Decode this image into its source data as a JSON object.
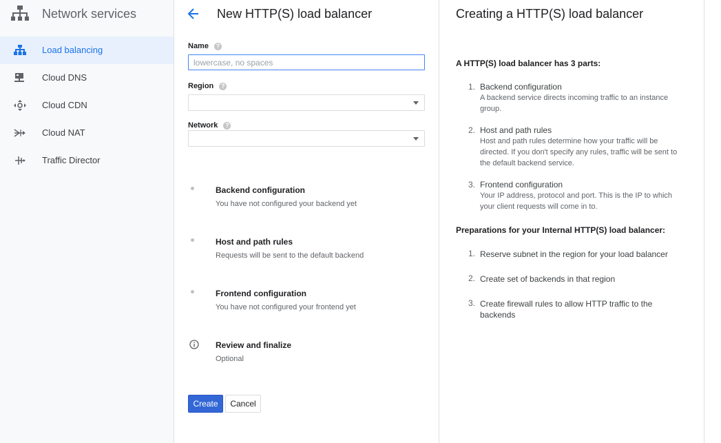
{
  "sidebar": {
    "title": "Network services",
    "items": [
      {
        "label": "Load balancing",
        "icon": "load-balancing-icon"
      },
      {
        "label": "Cloud DNS",
        "icon": "cloud-dns-icon"
      },
      {
        "label": "Cloud CDN",
        "icon": "cloud-cdn-icon"
      },
      {
        "label": "Cloud NAT",
        "icon": "cloud-nat-icon"
      },
      {
        "label": "Traffic Director",
        "icon": "traffic-director-icon"
      }
    ]
  },
  "main": {
    "title": "New HTTP(S) load balancer",
    "name_label": "Name",
    "name_placeholder": "lowercase, no spaces",
    "name_value": "",
    "region_label": "Region",
    "region_value": "",
    "network_label": "Network",
    "network_value": "",
    "steps": [
      {
        "title": "Backend configuration",
        "desc": "You have not configured your backend yet"
      },
      {
        "title": "Host and path rules",
        "desc": "Requests will be sent to the default backend"
      },
      {
        "title": "Frontend configuration",
        "desc": "You have not configured your frontend yet"
      },
      {
        "title": "Review and finalize",
        "desc": "Optional"
      }
    ],
    "create_label": "Create",
    "cancel_label": "Cancel"
  },
  "help": {
    "title": "Creating a HTTP(S) load balancer",
    "parts_heading": "A HTTP(S) load balancer has 3 parts:",
    "parts": [
      {
        "num": "1.",
        "title": "Backend configuration",
        "desc": "A backend service directs incoming traffic to an instance group."
      },
      {
        "num": "2.",
        "title": "Host and path rules",
        "desc": "Host and path rules determine how your traffic will be directed. If you don't specify any rules, traffic will be sent to the default backend service."
      },
      {
        "num": "3.",
        "title": "Frontend configuration",
        "desc": "Your IP address, protocol and port. This is the IP to which your client requests will come in to."
      }
    ],
    "prep_heading": "Preparations for your Internal HTTP(S) load balancer:",
    "preps": [
      {
        "num": "1.",
        "text": "Reserve subnet in the region for your load balancer"
      },
      {
        "num": "2.",
        "text": "Create set of backends in that region"
      },
      {
        "num": "3.",
        "text": "Create firewall rules to allow HTTP traffic to the backends"
      }
    ]
  },
  "colors": {
    "accent": "#1a73e8",
    "primary_button": "#3367d6",
    "active_nav_bg": "#e8f0fe"
  }
}
